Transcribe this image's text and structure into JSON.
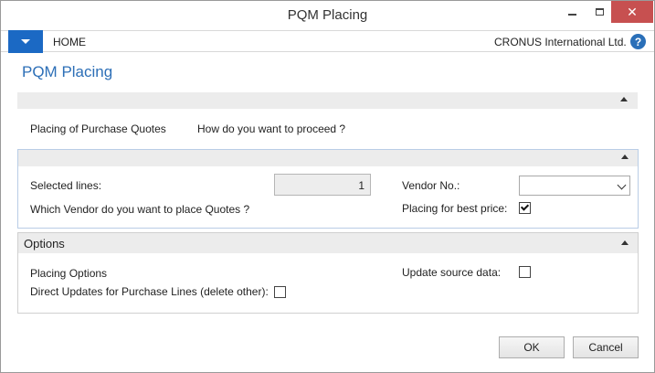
{
  "window": {
    "title": "PQM Placing",
    "close_glyph": "✕"
  },
  "ribbon": {
    "home_tab": "HOME",
    "company": "CRONUS International Ltd.",
    "help_glyph": "?"
  },
  "page": {
    "title": "PQM Placing"
  },
  "intro": {
    "label": "Placing of Purchase Quotes",
    "question": "How do you want to proceed ?"
  },
  "general": {
    "selected_lines_label": "Selected lines:",
    "selected_lines_value": "1",
    "which_vendor_label": "Which Vendor do you want to place Quotes ?",
    "vendor_no_label": "Vendor No.:",
    "vendor_no_value": "",
    "best_price_label": "Placing for best price:",
    "best_price_checked": true
  },
  "options": {
    "title": "Options",
    "placing_options_label": "Placing Options",
    "direct_updates_label": "Direct Updates for Purchase Lines (delete other):",
    "direct_updates_checked": false,
    "update_source_label": "Update source data:",
    "update_source_checked": false
  },
  "buttons": {
    "ok": "OK",
    "cancel": "Cancel"
  },
  "colors": {
    "accent": "#1b69c4",
    "title_blue": "#2d6fb7",
    "close_red": "#c75050"
  }
}
